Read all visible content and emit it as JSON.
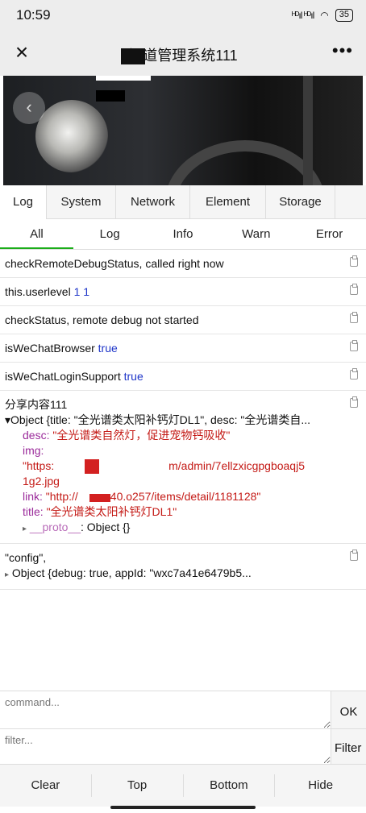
{
  "status": {
    "time": "10:59",
    "signal": "ᴴᴰıl ᴴᴰıl",
    "battery": "35"
  },
  "nav": {
    "title": "渠道管理系统111",
    "close": "×",
    "more": "•••"
  },
  "tabs": [
    "Log",
    "System",
    "Network",
    "Element",
    "Storage"
  ],
  "subtabs": [
    "All",
    "Log",
    "Info",
    "Warn",
    "Error"
  ],
  "logs": {
    "l1": "checkRemoteDebugStatus, called right now",
    "l2_text": "this.userlevel",
    "l2_val": "1 1",
    "l3": "checkStatus, remote debug not started",
    "l4_text": "isWeChatBrowser",
    "l4_val": "true",
    "l5_text": "isWeChatLoginSupport",
    "l5_val": "true",
    "share_title": "分享内容111",
    "obj_summary": "Object {title: \"全光谱类太阳补钙灯DL1\", desc: \"全光谱类自...",
    "desc_key": "desc:",
    "desc_val": "\"全光谱类自然灯，促进宠物钙吸收\"",
    "img_key": "img:",
    "img_val_a": "\"https:",
    "img_val_b": "m/admin/7ellzxicgpgboaqj5",
    "img_val_c": "1g2.jpg",
    "link_key": "link:",
    "link_val_a": "\"http://",
    "link_val_b": "40.o257/items/detail/1181128\"",
    "title_key": "title:",
    "title_val": "\"全光谱类太阳补钙灯DL1\"",
    "proto_key": "__proto__",
    "proto_val": ": Object {}",
    "config_label": "\"config\",",
    "config_obj": "Object {debug: true, appId: \"wxc7a41e6479b5..."
  },
  "command": {
    "placeholder": "command...",
    "button": "OK"
  },
  "filter": {
    "placeholder": "filter...",
    "button": "Filter"
  },
  "toolbar": [
    "Clear",
    "Top",
    "Bottom",
    "Hide"
  ]
}
